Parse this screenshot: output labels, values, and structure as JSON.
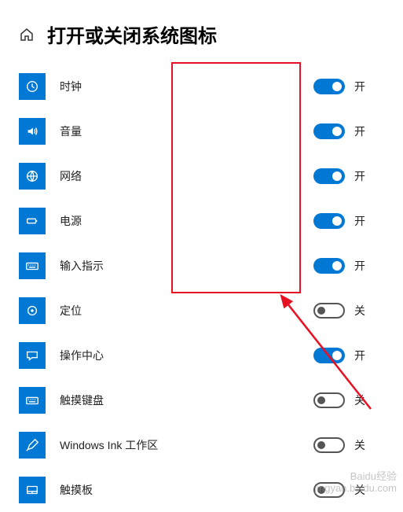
{
  "topBar": "",
  "header": {
    "title": "打开或关闭系统图标"
  },
  "labels": {
    "on": "开",
    "off": "关"
  },
  "items": [
    {
      "id": "clock",
      "label": "时钟",
      "on": true,
      "icon": "clock"
    },
    {
      "id": "volume",
      "label": "音量",
      "on": true,
      "icon": "volume"
    },
    {
      "id": "network",
      "label": "网络",
      "on": true,
      "icon": "globe"
    },
    {
      "id": "power",
      "label": "电源",
      "on": true,
      "icon": "battery"
    },
    {
      "id": "input",
      "label": "输入指示",
      "on": true,
      "icon": "keyboard"
    },
    {
      "id": "location",
      "label": "定位",
      "on": false,
      "icon": "target"
    },
    {
      "id": "action-center",
      "label": "操作中心",
      "on": true,
      "icon": "chat"
    },
    {
      "id": "touch-keyboard",
      "label": "触摸键盘",
      "on": false,
      "icon": "keyboard"
    },
    {
      "id": "windows-ink",
      "label": "Windows Ink 工作区",
      "on": false,
      "icon": "pen"
    },
    {
      "id": "touchpad",
      "label": "触摸板",
      "on": false,
      "icon": "touchpad"
    }
  ],
  "watermark": {
    "line1": "Baidu经验",
    "line2": "jingyan.baidu.com"
  }
}
